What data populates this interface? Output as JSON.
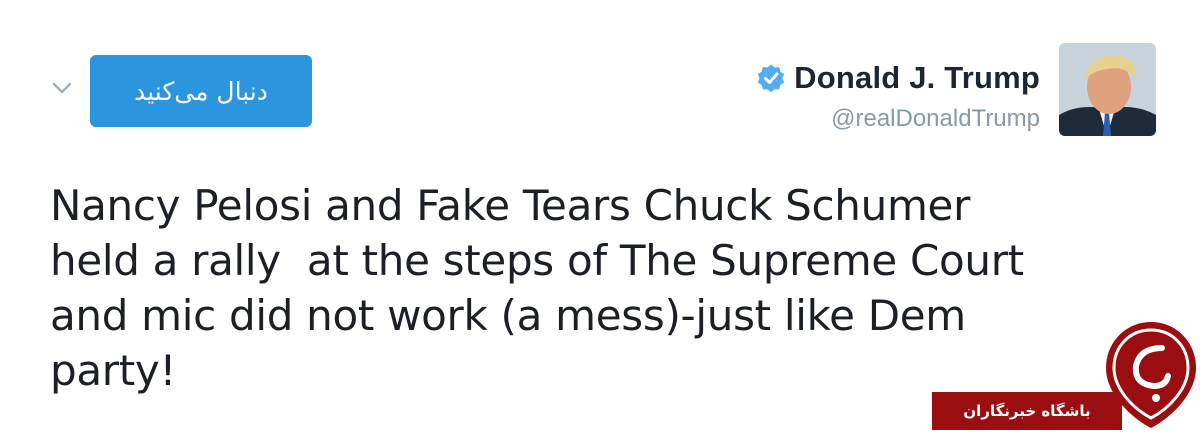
{
  "tweet": {
    "display_name": "Donald J. Trump",
    "handle": "@realDonaldTrump",
    "follow_label": "دنبال می‌کنید",
    "text_lines": [
      "Nancy Pelosi and Fake Tears Chuck Schumer",
      "held a rally  at the steps of The Supreme Court",
      "and mic did not work (a mess)-just like Dem",
      "party!"
    ]
  },
  "watermark": {
    "label": "باشگاه خبرنگاران"
  },
  "colors": {
    "follow_button": "#2b95dd",
    "verified_badge": "#55acee",
    "handle_text": "#8899a6",
    "watermark_red": "#9a0e12"
  },
  "icons": [
    "chevron-down-icon",
    "verified-badge-icon",
    "avatar",
    "watermark-logo"
  ]
}
